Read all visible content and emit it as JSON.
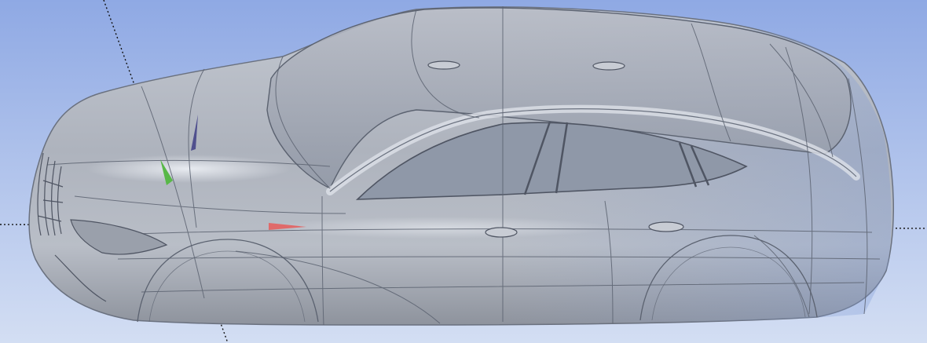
{
  "viewport": {
    "background_top": "#8fa9e4",
    "background_bottom": "#d3def3"
  },
  "model": {
    "body_color": "#a9afba",
    "glass_color": "#8f98a8",
    "edge_color": "#5b6270",
    "highlight_color": "#e6e9ef"
  },
  "triad": {
    "x_axis_color": "#e06a6a",
    "y_axis_color": "#58b848",
    "z_axis_color": "#50508e"
  },
  "symmetry_line_color": "#111111"
}
